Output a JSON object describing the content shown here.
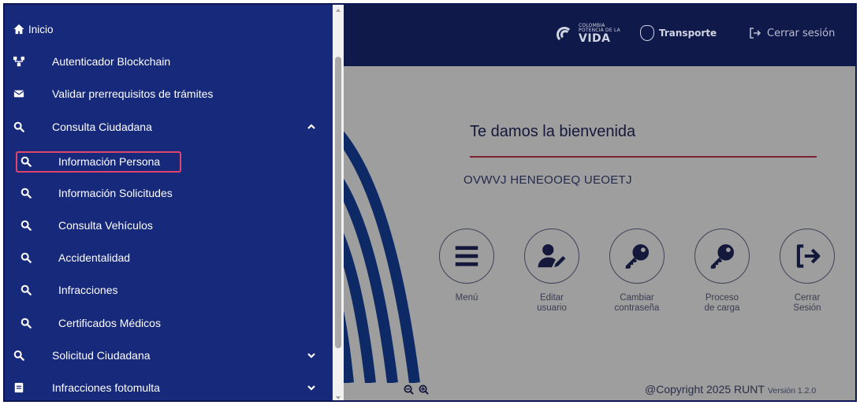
{
  "header": {
    "brand_small": "COLOMBIA",
    "brand_small2": "POTENCIA DE LA",
    "brand_big": "VIDA",
    "ministry": "Transporte",
    "logout": "Cerrar sesión"
  },
  "welcome": {
    "title": "Te damos la bienvenida",
    "user_name": "OVWVJ HENEOOEQ UEOETJ"
  },
  "shortcuts": [
    {
      "label": "Menú",
      "icon": "menu-icon"
    },
    {
      "label": "Editar\nusuario",
      "icon": "user-edit-icon"
    },
    {
      "label": "Cambiar\ncontraseña",
      "icon": "key-icon"
    },
    {
      "label": "Proceso\nde carga",
      "icon": "key-icon"
    },
    {
      "label": "Cerrar\nSesión",
      "icon": "logout-icon"
    }
  ],
  "footer": {
    "copyright": "@Copyright 2025 RUNT",
    "version": "Versión 1.2.0"
  },
  "menu": {
    "items": [
      {
        "label": "Inicio",
        "icon": "home-icon"
      },
      {
        "label": "Autenticador Blockchain",
        "icon": "network-icon"
      },
      {
        "label": "Validar prerrequisitos de trámites",
        "icon": "envelope-icon"
      },
      {
        "label": "Consulta Ciudadana",
        "icon": "search-icon",
        "state": "expanded"
      },
      {
        "label": "Información Persona",
        "icon": "search-icon",
        "selected": true
      },
      {
        "label": "Información Solicitudes",
        "icon": "search-icon"
      },
      {
        "label": "Consulta Vehículos",
        "icon": "search-icon"
      },
      {
        "label": "Accidentalidad",
        "icon": "search-icon"
      },
      {
        "label": "Infracciones",
        "icon": "search-icon"
      },
      {
        "label": "Certificados Médicos",
        "icon": "search-icon"
      },
      {
        "label": "Solicitud Ciudadana",
        "icon": "search-icon",
        "state": "collapsed"
      },
      {
        "label": "Infracciones fotomulta",
        "icon": "document-icon",
        "state": "collapsed"
      }
    ]
  },
  "colors": {
    "drawer_bg": "#17297a",
    "header_bg": "#101a4a",
    "highlight": "#e2456b",
    "accent_rule": "#7b2130"
  }
}
